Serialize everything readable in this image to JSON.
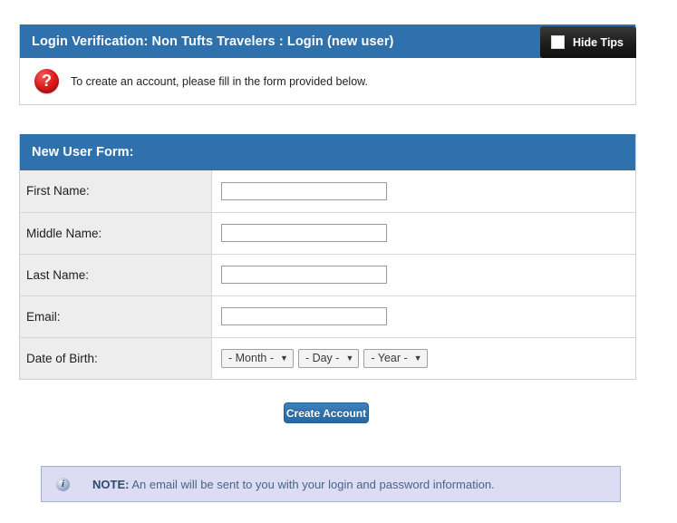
{
  "tips_panel": {
    "title": "Login Verification: Non Tufts Travelers : Login (new user)",
    "hide_tips_button": {
      "label": "Hide Tips",
      "checkbox_icon": "checkbox-unchecked-icon",
      "checked": false
    },
    "help_icon": "help-question-icon",
    "help_icon_glyph": "?",
    "tip_text": "To create an account, please fill in the form provided below."
  },
  "form_panel": {
    "title": "New User Form:",
    "rows": [
      {
        "label": "First Name:",
        "type": "text",
        "value": "",
        "placeholder": ""
      },
      {
        "label": "Middle Name:",
        "type": "text",
        "value": "",
        "placeholder": ""
      },
      {
        "label": "Last Name:",
        "type": "text",
        "value": "",
        "placeholder": ""
      },
      {
        "label": "Email:",
        "type": "text",
        "value": "",
        "placeholder": ""
      },
      {
        "label": "Date of Birth:",
        "type": "date-selects"
      }
    ],
    "date_of_birth": {
      "month": {
        "selected": "- Month -",
        "caret_icon": "chevron-down-icon"
      },
      "day": {
        "selected": "- Day -",
        "caret_icon": "chevron-down-icon"
      },
      "year": {
        "selected": "- Year -",
        "caret_icon": "chevron-down-icon"
      }
    }
  },
  "actions": {
    "create_account_label": "Create Account"
  },
  "note_bar": {
    "icon": "info-circle-icon",
    "icon_glyph": "i",
    "prefix": "NOTE:",
    "text": " An email will be sent to you with your login and password information."
  },
  "colors": {
    "panel_header_blue": "#2f71ad",
    "hide_tips_black": "#1d1d1d",
    "help_icon_red": "#e01b1b",
    "label_cell_gray": "#ededed",
    "note_bar_lavender": "#dcdcf5",
    "note_text_blue": "#4a6585",
    "page_background": "#ffffff"
  }
}
